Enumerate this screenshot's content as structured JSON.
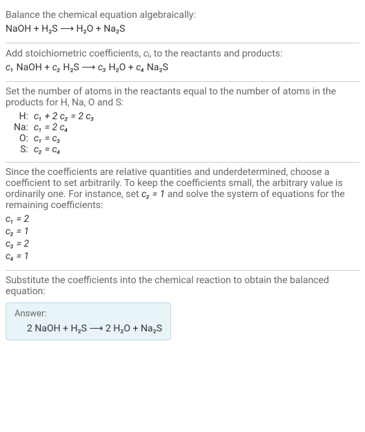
{
  "sec1": {
    "heading": "Balance the chemical equation algebraically:",
    "eq": "NaOH + H₂S ⟶ H₂O + Na₂S"
  },
  "sec2": {
    "heading_a": "Add stoichiometric coefficients, ",
    "heading_ci": "cᵢ",
    "heading_b": ", to the reactants and products:",
    "eq_c1": "c₁",
    "eq_r1": " NaOH + ",
    "eq_c2": "c₂",
    "eq_r2": " H₂S ⟶ ",
    "eq_c3": "c₃",
    "eq_r3": " H₂O + ",
    "eq_c4": "c₄",
    "eq_r4": " Na₂S"
  },
  "sec3": {
    "heading": "Set the number of atoms in the reactants equal to the number of atoms in the products for H, Na, O and S:",
    "rows": [
      {
        "el": "H:",
        "eq_a": "c₁ + 2 c₂ = 2 c₃"
      },
      {
        "el": "Na:",
        "eq_a": "c₁ = 2 c₄"
      },
      {
        "el": "O:",
        "eq_a": "c₁ = c₃"
      },
      {
        "el": "S:",
        "eq_a": "c₂ = c₄"
      }
    ]
  },
  "sec4": {
    "heading_a": "Since the coefficients are relative quantities and underdetermined, choose a coefficient to set arbitrarily. To keep the coefficients small, the arbitrary value is ordinarily one. For instance, set ",
    "heading_c2": "c₂ = 1",
    "heading_b": " and solve the system of equations for the remaining coefficients:",
    "sol": [
      "c₁ = 2",
      "c₂ = 1",
      "c₃ = 2",
      "c₄ = 1"
    ]
  },
  "sec5": {
    "heading": "Substitute the coefficients into the chemical reaction to obtain the balanced equation:",
    "answer_label": "Answer:",
    "answer_eq": "2 NaOH + H₂S ⟶ 2 H₂O + Na₂S"
  },
  "chart_data": {
    "type": "table",
    "title": "Chemical equation balancing",
    "unbalanced_equation": "NaOH + H2S -> H2O + Na2S",
    "atom_balance_equations": [
      {
        "element": "H",
        "equation": "c1 + 2 c2 = 2 c3"
      },
      {
        "element": "Na",
        "equation": "c1 = 2 c4"
      },
      {
        "element": "O",
        "equation": "c1 = c3"
      },
      {
        "element": "S",
        "equation": "c2 = c4"
      }
    ],
    "fixed_coefficient": {
      "name": "c2",
      "value": 1
    },
    "coefficient_solution": {
      "c1": 2,
      "c2": 1,
      "c3": 2,
      "c4": 1
    },
    "balanced_equation": "2 NaOH + H2S -> 2 H2O + Na2S"
  }
}
